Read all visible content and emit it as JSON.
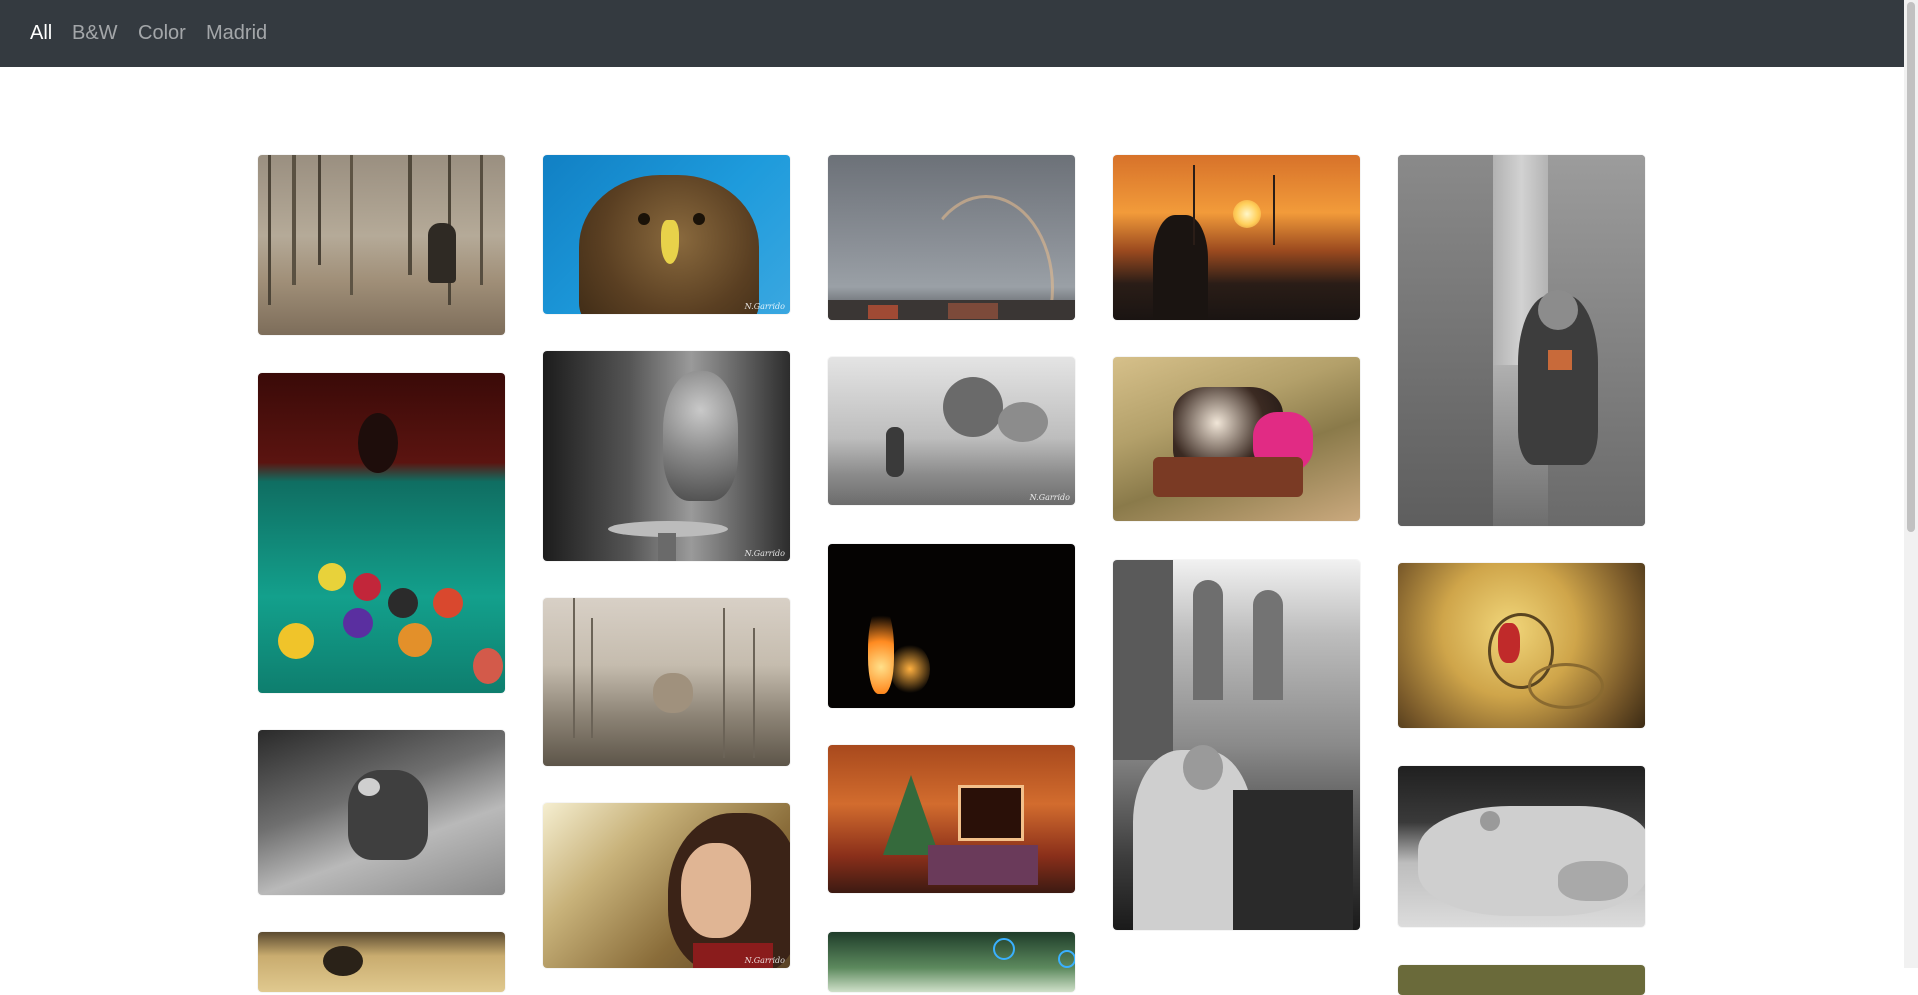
{
  "nav": {
    "items": [
      {
        "label": "All",
        "active": true
      },
      {
        "label": "B&W",
        "active": false
      },
      {
        "label": "Color",
        "active": false
      },
      {
        "label": "Madrid",
        "active": false
      }
    ]
  },
  "gallery": {
    "photos": [
      {
        "id": "woman-forest",
        "subject": "woman in bare forest",
        "style": "sepia",
        "watermark": ""
      },
      {
        "id": "eagle",
        "subject": "eagle on blue sky",
        "style": "color",
        "watermark": "N.Garrido"
      },
      {
        "id": "rainbow-birds",
        "subject": "rainbow with birds over city",
        "style": "color",
        "watermark": ""
      },
      {
        "id": "sunset-road",
        "subject": "sunset road with people",
        "style": "color",
        "watermark": ""
      },
      {
        "id": "memorial-woman",
        "subject": "woman crouching between concrete blocks",
        "style": "bw-color",
        "watermark": ""
      },
      {
        "id": "pool-table",
        "subject": "billiard balls on pool table",
        "style": "color",
        "watermark": ""
      },
      {
        "id": "owl",
        "subject": "owl on a perch",
        "style": "bw",
        "watermark": "N.Garrido"
      },
      {
        "id": "foggy-path",
        "subject": "person walking foggy path",
        "style": "bw",
        "watermark": "N.Garrido"
      },
      {
        "id": "wheelbarrow-kids",
        "subject": "kids in a cart on dirt road",
        "style": "color",
        "watermark": ""
      },
      {
        "id": "fire-dark",
        "subject": "flames in darkness",
        "style": "color",
        "watermark": ""
      },
      {
        "id": "ruins-crowd",
        "subject": "crowd in old church ruins",
        "style": "bw",
        "watermark": ""
      },
      {
        "id": "stairwell",
        "subject": "spiral stairwell with graffiti",
        "style": "color",
        "watermark": ""
      },
      {
        "id": "cat-grass",
        "subject": "cat in tall grass",
        "style": "sepia",
        "watermark": ""
      },
      {
        "id": "christmas-room",
        "subject": "room with christmas tree",
        "style": "color",
        "watermark": ""
      },
      {
        "id": "cat-stairs",
        "subject": "cat on stairs",
        "style": "bw",
        "watermark": ""
      },
      {
        "id": "butterfly-hand",
        "subject": "butterfly on hand",
        "style": "bw",
        "watermark": ""
      },
      {
        "id": "curly-girl",
        "subject": "curly haired girl in autumn",
        "style": "color",
        "watermark": "N.Garrido"
      },
      {
        "id": "partial-wheat",
        "subject": "field",
        "style": "color",
        "watermark": ""
      },
      {
        "id": "partial-bubbles",
        "subject": "trees with bubbles",
        "style": "color",
        "watermark": ""
      },
      {
        "id": "partial-last",
        "subject": "landscape",
        "style": "color",
        "watermark": ""
      }
    ]
  }
}
